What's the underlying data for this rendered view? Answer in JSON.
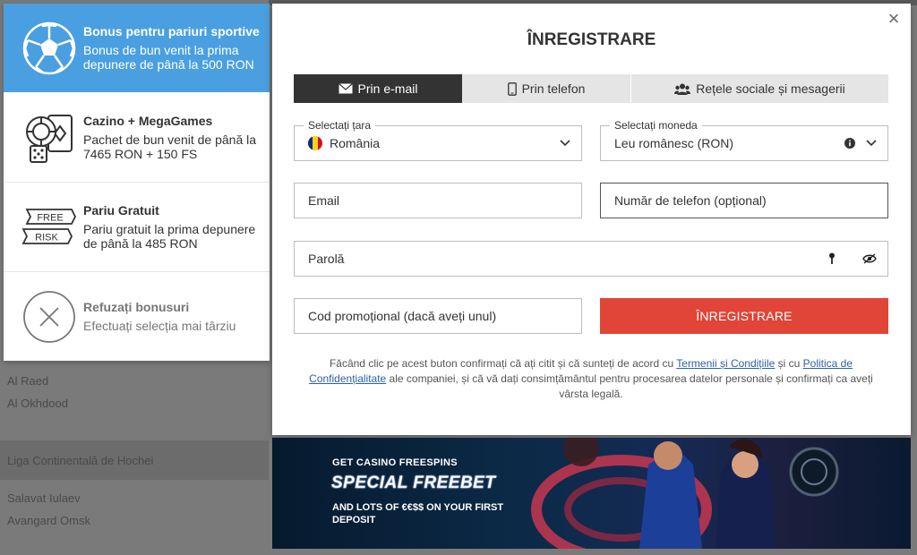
{
  "background": {
    "rows": [
      {
        "text": "Al Raed"
      },
      {
        "text": "Al Okhdood"
      },
      {
        "text": "Liga Continentală de Hochei"
      },
      {
        "text": "Salavat Iulaev"
      },
      {
        "text": "Avangard Omsk"
      }
    ]
  },
  "bonus_panel": {
    "items": [
      {
        "title": "Bonus pentru pariuri sportive",
        "desc": "Bonus de bun venit la prima depunere de până la 500 RON",
        "icon": "soccer-ball-icon"
      },
      {
        "title": "Cazino + MegaGames",
        "desc": "Pachet de bun venit de până la 7465 RON + 150 FS",
        "icon": "casino-chips-icon"
      },
      {
        "title": "Pariu Gratuit",
        "desc": "Pariu gratuit la prima depunere de până la 485 RON",
        "icon": "free-risk-icon",
        "icon_text_top": "FREE",
        "icon_text_bottom": "RISK"
      },
      {
        "title": "Refuzați bonusuri",
        "desc": "Efectuați selecția mai târziu",
        "icon": "close-circle-icon"
      }
    ]
  },
  "modal": {
    "title": "ÎNREGISTRARE",
    "close_label": "×",
    "tabs": [
      {
        "label": "Prin e-mail",
        "icon": "envelope-icon"
      },
      {
        "label": "Prin telefon",
        "icon": "phone-icon"
      },
      {
        "label": "Rețele sociale și mesagerii",
        "icon": "users-icon"
      }
    ],
    "country": {
      "label": "Selectați țara",
      "value": "România"
    },
    "currency": {
      "label": "Selectați moneda",
      "value": "Leu românesc (RON)"
    },
    "email": {
      "placeholder": "Email"
    },
    "phone": {
      "placeholder": "Număr de telefon (opțional)"
    },
    "password": {
      "placeholder": "Parolă"
    },
    "promo": {
      "placeholder": "Cod promoțional (dacă aveți unul)"
    },
    "register_button": "ÎNREGISTRARE",
    "terms": {
      "text_1": "Făcând clic pe acest buton confirmați că ați citit și că sunteți de acord cu ",
      "link_1": "Termenii și Condițiile",
      "text_2": " și cu ",
      "link_2": "Politica de Confidențialitate",
      "text_3": " ale companiei, și că vă dați consimțământul pentru procesarea datelor personale și confirmați ca aveți vârsta legală."
    }
  },
  "banner": {
    "line1": "GET CASINO FREESPINS",
    "line2": "SPECIAL FREEBET",
    "line3": "AND LOTS OF €€$$ ON YOUR FIRST DEPOSIT"
  },
  "colors": {
    "accent_blue": "#4a9fe0",
    "register_red": "#e04537",
    "tab_dark": "#333333",
    "link": "#2d5fa6"
  }
}
